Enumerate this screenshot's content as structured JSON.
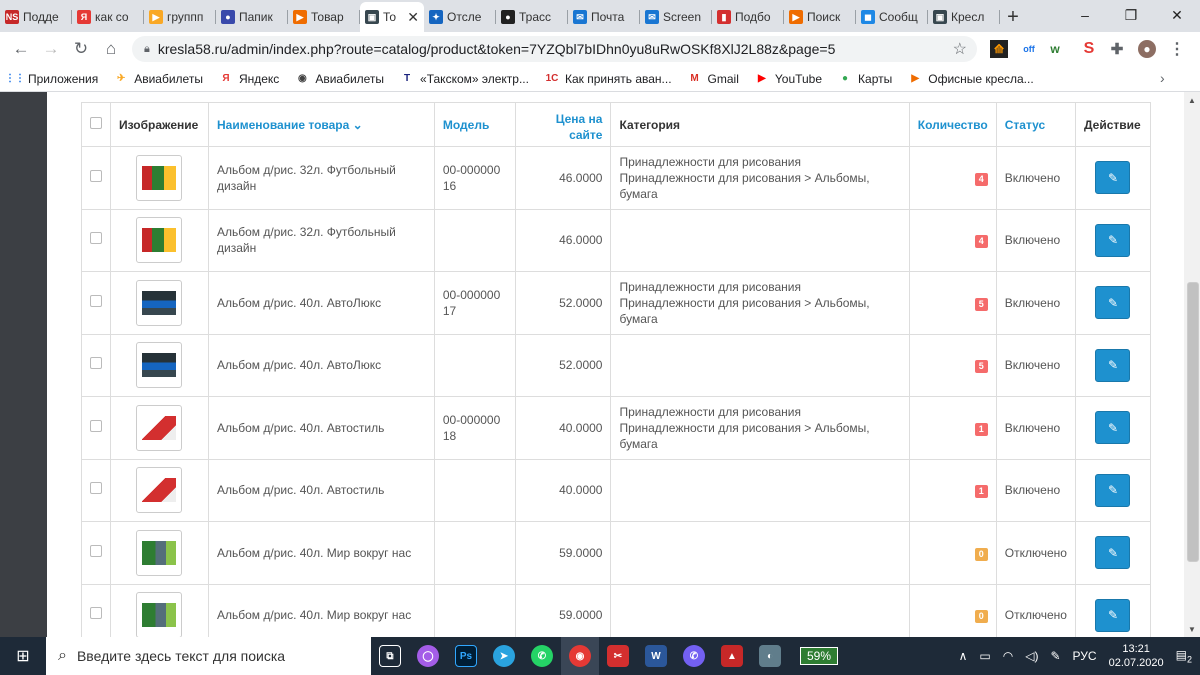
{
  "browser": {
    "tabs": [
      {
        "label": "Подде",
        "fav": "NS",
        "color": "#c62828",
        "bg": "#fff"
      },
      {
        "label": "как со",
        "fav": "Я",
        "color": "#e53935",
        "bg": "#dee1e6"
      },
      {
        "label": "группп",
        "fav": "▶",
        "color": "#f9a825",
        "bg": "#dee1e6"
      },
      {
        "label": "Папик",
        "fav": "●",
        "color": "#3949ab",
        "bg": "#dee1e6"
      },
      {
        "label": "Товар",
        "fav": "▶",
        "color": "#ef6c00",
        "bg": "#dee1e6"
      },
      {
        "label": "То",
        "fav": "▣",
        "color": "#37474f",
        "bg": "#fff",
        "active": true
      },
      {
        "label": "Отсле",
        "fav": "✦",
        "color": "#1565c0",
        "bg": "#dee1e6"
      },
      {
        "label": "Трасс",
        "fav": "●",
        "color": "#212121",
        "bg": "#dee1e6"
      },
      {
        "label": "Почта",
        "fav": "✉",
        "color": "#1976d2",
        "bg": "#dee1e6"
      },
      {
        "label": "Screen",
        "fav": "✉",
        "color": "#1976d2",
        "bg": "#dee1e6"
      },
      {
        "label": "Подбо",
        "fav": "▮",
        "color": "#d32f2f",
        "bg": "#dee1e6"
      },
      {
        "label": "Поиск",
        "fav": "▶",
        "color": "#ef6c00",
        "bg": "#dee1e6"
      },
      {
        "label": "Сообщ",
        "fav": "◼",
        "color": "#1e88e5",
        "bg": "#dee1e6"
      },
      {
        "label": "Кресл",
        "fav": "▣",
        "color": "#37474f",
        "bg": "#dee1e6"
      }
    ],
    "new_tab": "+",
    "window_controls": [
      "–",
      "❐",
      "✕"
    ],
    "url": "kresla58.ru/admin/index.php?route=catalog/product&token=7YZQbl7bIDhn0yu8uRwOSKf8XlJ2L88z&page=5",
    "bookmarks": [
      {
        "label": "Приложения",
        "icon": "apps-icon",
        "glyph": "⋮⋮",
        "color": "#1a73e8"
      },
      {
        "label": "Авиабилеты",
        "icon": "plane-icon",
        "glyph": "✈",
        "color": "#f9a825"
      },
      {
        "label": "Яндекс",
        "icon": "yandex-icon",
        "glyph": "Я",
        "color": "#e53935"
      },
      {
        "label": "Авиабилеты",
        "icon": "globe-icon",
        "glyph": "◉",
        "color": "#424242"
      },
      {
        "label": "«Такском» электр...",
        "icon": "taxcom-icon",
        "glyph": "T",
        "color": "#1a237e"
      },
      {
        "label": "Как принять аван...",
        "icon": "1c-icon",
        "glyph": "1C",
        "color": "#d32f2f"
      },
      {
        "label": "Gmail",
        "icon": "gmail-icon",
        "glyph": "M",
        "color": "#d93025"
      },
      {
        "label": "YouTube",
        "icon": "youtube-icon",
        "glyph": "▶",
        "color": "#ff0000"
      },
      {
        "label": "Карты",
        "icon": "maps-icon",
        "glyph": "●",
        "color": "#34a853"
      },
      {
        "label": "Офисные кресла...",
        "icon": "chair-icon",
        "glyph": "▶",
        "color": "#ef6c00"
      }
    ]
  },
  "table": {
    "headers": {
      "image": "Изображение",
      "name": "Наименование товара",
      "model": "Модель",
      "price": "Цена на сайте",
      "category": "Категория",
      "quantity": "Количество",
      "status": "Статус",
      "action": "Действие"
    },
    "rows": [
      {
        "name": "Альбом д/рис. 32л. Футбольный дизайн",
        "model": "00-00000016",
        "price": "46.0000",
        "category1": "Принадлежности для рисования",
        "category2": "Принадлежности для рисования  >  Альбомы, бумага",
        "qty": "4",
        "qty_color": "#f56b6b",
        "status": "Включено",
        "thumb": "football"
      },
      {
        "name": "Альбом д/рис. 32л. Футбольный дизайн",
        "model": "",
        "price": "46.0000",
        "category1": "",
        "category2": "",
        "qty": "4",
        "qty_color": "#f56b6b",
        "status": "Включено",
        "thumb": "football"
      },
      {
        "name": "Альбом д/рис. 40л. АвтоЛюкс",
        "model": "00-00000017",
        "price": "52.0000",
        "category1": "Принадлежности для рисования",
        "category2": "Принадлежности для рисования  >  Альбомы, бумага",
        "qty": "5",
        "qty_color": "#f56b6b",
        "status": "Включено",
        "thumb": "auto"
      },
      {
        "name": "Альбом д/рис. 40л. АвтоЛюкс",
        "model": "",
        "price": "52.0000",
        "category1": "",
        "category2": "",
        "qty": "5",
        "qty_color": "#f56b6b",
        "status": "Включено",
        "thumb": "auto"
      },
      {
        "name": "Альбом д/рис. 40л. Автостиль",
        "model": "00-00000018",
        "price": "40.0000",
        "category1": "Принадлежности для рисования",
        "category2": "Принадлежности для рисования  >  Альбомы, бумага",
        "qty": "1",
        "qty_color": "#f56b6b",
        "status": "Включено",
        "thumb": "autostyle"
      },
      {
        "name": "Альбом д/рис. 40л. Автостиль",
        "model": "",
        "price": "40.0000",
        "category1": "",
        "category2": "",
        "qty": "1",
        "qty_color": "#f56b6b",
        "status": "Включено",
        "thumb": "autostyle"
      },
      {
        "name": "Альбом д/рис. 40л. Мир вокруг нас",
        "model": "",
        "price": "59.0000",
        "category1": "",
        "category2": "",
        "qty": "0",
        "qty_color": "#f0ad4e",
        "status": "Отключено",
        "thumb": "world"
      },
      {
        "name": "Альбом д/рис. 40л. Мир вокруг нас",
        "model": "",
        "price": "59.0000",
        "category1": "",
        "category2": "",
        "qty": "0",
        "qty_color": "#f0ad4e",
        "status": "Отключено",
        "thumb": "world"
      }
    ]
  },
  "taskbar": {
    "search_placeholder": "Введите здесь текст для поиска",
    "battery": "59%",
    "language": "РУС",
    "time": "13:21",
    "date": "02.07.2020",
    "notifications": "2"
  }
}
